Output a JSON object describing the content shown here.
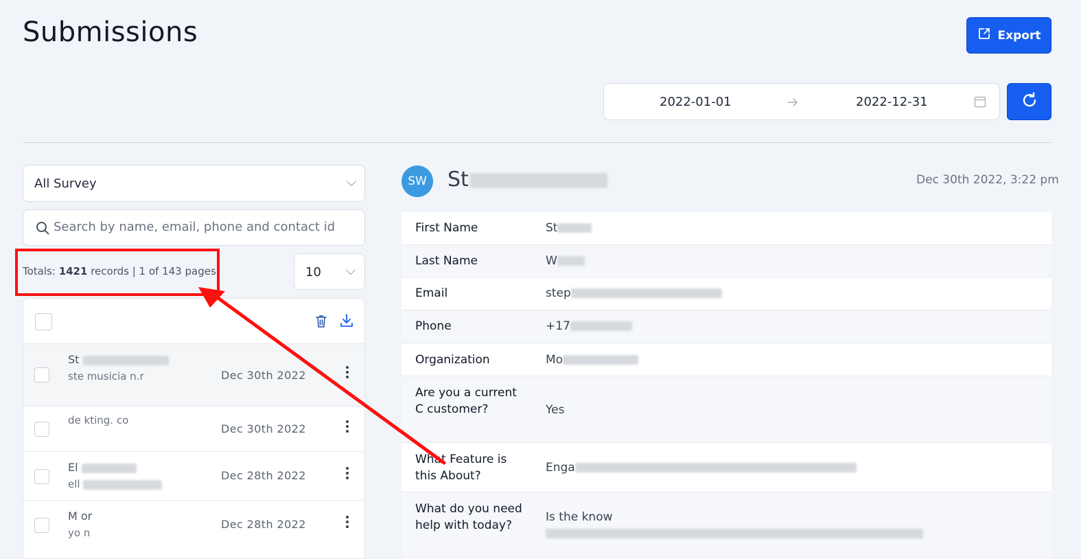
{
  "header": {
    "title": "Submissions",
    "export_label": "Export"
  },
  "date_range": {
    "start": "2022-01-01",
    "end": "2022-12-31"
  },
  "filters": {
    "survey_selected": "All Survey",
    "search_placeholder": "Search by name, email, phone and contact id",
    "page_size": "10"
  },
  "totals": {
    "prefix": "Totals:",
    "records": "1421",
    "suffix": "records | 1 of 143 pages"
  },
  "submissions": [
    {
      "name": "St",
      "sub": "ste musicia n.r",
      "date": "Dec 30th 2022"
    },
    {
      "name": "",
      "sub": "de kting. co",
      "date": "Dec 30th 2022"
    },
    {
      "name": "El",
      "sub": "ell",
      "date": "Dec 28th 2022"
    },
    {
      "name": "M or",
      "sub": "yo n",
      "date": "Dec 28th 2022"
    }
  ],
  "contact": {
    "initials": "SW",
    "name": "St",
    "date": "Dec 30th 2022, 3:22 pm"
  },
  "fields": [
    {
      "label": "First Name",
      "value": "St"
    },
    {
      "label": "Last Name",
      "value": "W"
    },
    {
      "label": "Email",
      "value": "step"
    },
    {
      "label": "Phone",
      "value": "+17"
    },
    {
      "label": "Organization",
      "value": "Mo"
    },
    {
      "label": "Are you a current C customer?",
      "value": "Yes"
    },
    {
      "label": "What Feature is this About?",
      "value": "Enga"
    },
    {
      "label": "What do you need help with today?",
      "value": "Is the know"
    }
  ],
  "colors": {
    "primary": "#155eef",
    "annotation": "#ff1010",
    "avatar": "#3b9ae0",
    "background": "#f1f5f9"
  },
  "icons": {
    "export": "export-icon",
    "refresh": "refresh-icon",
    "calendar": "calendar-icon",
    "arrow": "arrow-right-icon",
    "search": "search-icon",
    "trash": "trash-icon",
    "download": "download-icon",
    "menu": "kebab-menu-icon"
  }
}
